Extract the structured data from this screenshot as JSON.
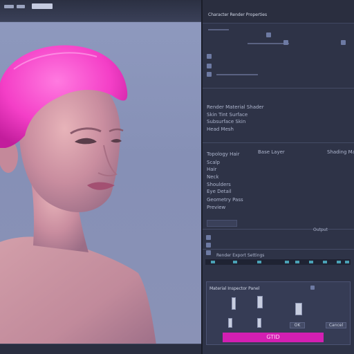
{
  "viewport": {
    "scene_description_label": "",
    "subject_hair_color": "#ff4fd0",
    "skin_color": "#d39aa8",
    "background_color": "#8c96ba"
  },
  "panel": {
    "header_title": "Character Render Properties",
    "toolbar_icons": [
      "folder-icon",
      "grid-icon",
      "eye-icon"
    ],
    "rows": [
      {
        "label": "Render Material Shader",
        "value": ""
      },
      {
        "label": "Skin Tint Surface",
        "value": ""
      },
      {
        "label": "Subsurface Skin",
        "value": ""
      },
      {
        "label": "Head Mesh",
        "value": ""
      },
      {
        "label": "Topology Hair",
        "value": "Base Layer",
        "value2": "Shading Mask"
      },
      {
        "label": "Scalp",
        "value": ""
      },
      {
        "label": "Hair",
        "value": ""
      },
      {
        "label": "Neck",
        "value": ""
      },
      {
        "label": "Shoulders",
        "value": ""
      },
      {
        "label": "Eye Detail",
        "value": ""
      },
      {
        "label": "Geometry Pass",
        "value": ""
      },
      {
        "label": "Preview",
        "value": ""
      }
    ],
    "section_label": "Output",
    "render_label": "Render Export Settings",
    "dock_title": "Material Inspector Panel",
    "magenta_button_label": "GTID",
    "dock_buttons": [
      "OK",
      "Cancel"
    ]
  },
  "colors": {
    "accent": "#d31fb2",
    "teal": "#2f7f86",
    "panel_bg": "#2e3347"
  }
}
